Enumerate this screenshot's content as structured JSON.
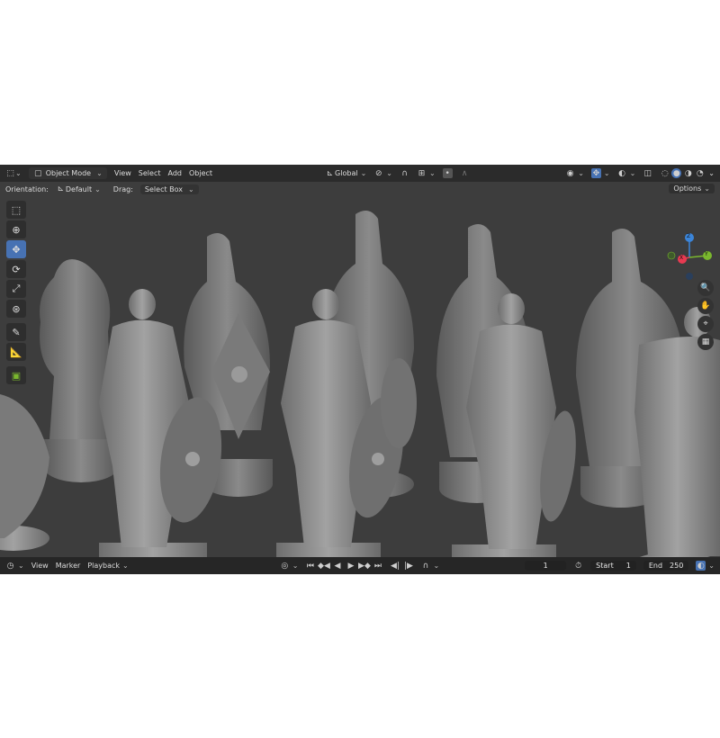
{
  "header": {
    "mode": "Object Mode",
    "menus": [
      "View",
      "Select",
      "Add",
      "Object"
    ],
    "transform_orientation": "Global"
  },
  "subheader": {
    "orientation_label": "Orientation:",
    "orientation_value": "Default",
    "drag_label": "Drag:",
    "drag_value": "Select Box",
    "options": "Options"
  },
  "gizmo": {
    "z": "Z",
    "y": "Y",
    "x": "X"
  },
  "timeline": {
    "menus": [
      "View",
      "Marker",
      "Playback"
    ],
    "current_frame": "1",
    "start_label": "Start",
    "start_value": "1",
    "end_label": "End",
    "end_value": "250"
  },
  "colors": {
    "accent": "#4772b3",
    "x_axis": "#e83a51",
    "y_axis": "#7ab72e",
    "z_axis": "#3b85d9"
  }
}
